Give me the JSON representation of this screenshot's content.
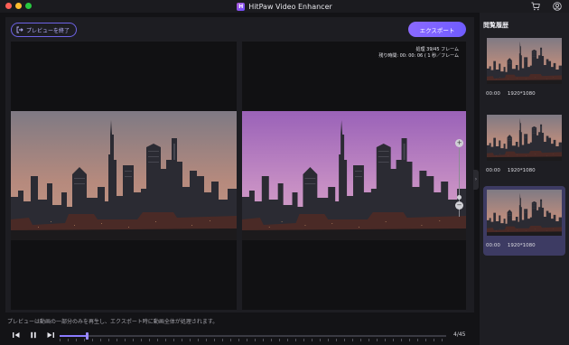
{
  "app": {
    "title": "HitPaw Video Enhancer",
    "logo_letter": "H",
    "icons": [
      "cart-icon",
      "account-icon"
    ]
  },
  "toolbar": {
    "end_preview_label": "プレビューを終了",
    "export_label": "エクスポート"
  },
  "preview": {
    "processing_line": "処理 39/45 フレーム",
    "remaining_line": "残り時間: 00: 00: 06 ( 1 秒／フレーム",
    "note": "プレビューは動画の一部分のみを再生し、エクスポート時に動画全体が処理されます。",
    "frame_counter": "4/45",
    "progress_fraction": 0.07
  },
  "sidebar": {
    "title": "閲覧履歴",
    "items": [
      {
        "time": "00:00",
        "resolution": "1920*1080",
        "selected": false
      },
      {
        "time": "00:00",
        "resolution": "1920*1080",
        "selected": false
      },
      {
        "time": "00:00",
        "resolution": "1920*1080",
        "selected": true
      }
    ]
  },
  "colors": {
    "accent": "#7a66ff",
    "window_bg": "#131316",
    "panel_bg": "#1d1d22",
    "sidebar_bg": "#1e1e23",
    "selected_card": "#3d3b63"
  }
}
